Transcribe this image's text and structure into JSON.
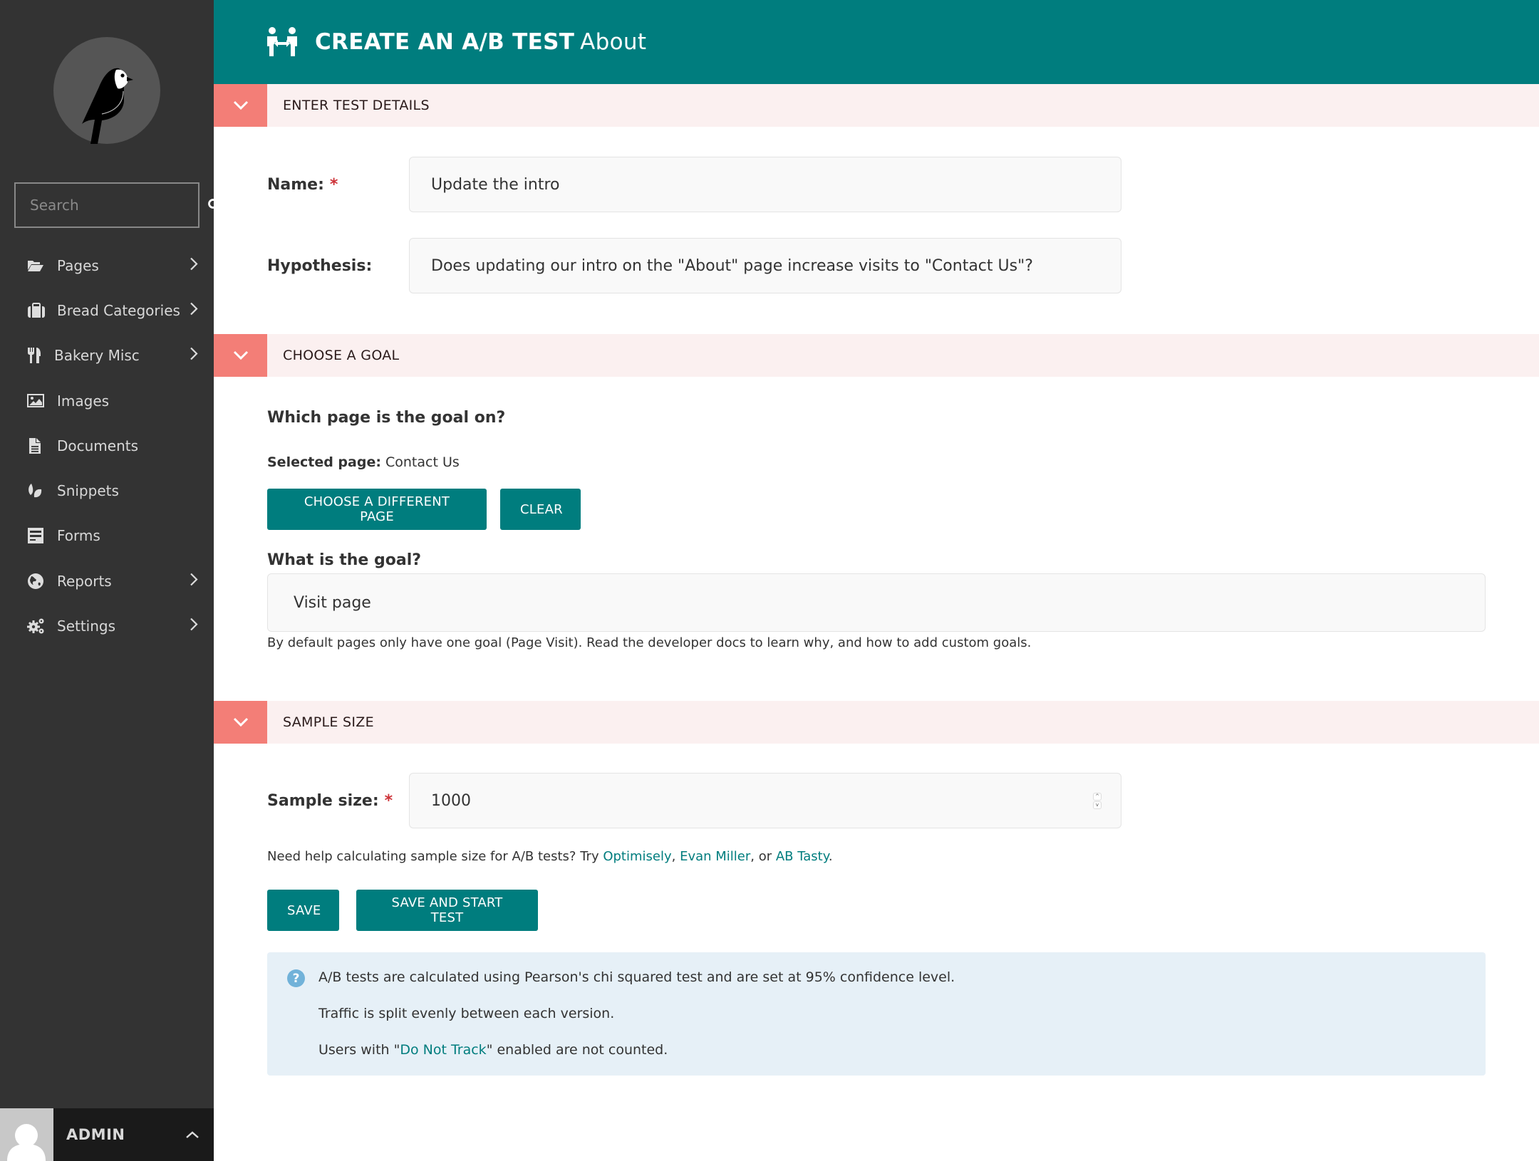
{
  "sidebar": {
    "search": {
      "placeholder": "Search"
    },
    "items": [
      {
        "label": "Pages",
        "icon": "folder-open-icon",
        "has_submenu": true
      },
      {
        "label": "Bread Categories",
        "icon": "suitcase-icon",
        "has_submenu": true
      },
      {
        "label": "Bakery Misc",
        "icon": "utensils-icon",
        "has_submenu": true
      },
      {
        "label": "Images",
        "icon": "image-icon",
        "has_submenu": false
      },
      {
        "label": "Documents",
        "icon": "document-icon",
        "has_submenu": false
      },
      {
        "label": "Snippets",
        "icon": "snippet-leaf-icon",
        "has_submenu": false
      },
      {
        "label": "Forms",
        "icon": "form-icon",
        "has_submenu": false
      },
      {
        "label": "Reports",
        "icon": "globe-icon",
        "has_submenu": true
      },
      {
        "label": "Settings",
        "icon": "cogs-icon",
        "has_submenu": true
      }
    ],
    "account": {
      "name": "ADMIN"
    }
  },
  "header": {
    "title": "CREATE AN A/B TEST",
    "subtitle": "About",
    "icon": "people-split-icon"
  },
  "sections": {
    "details": {
      "title": "ENTER TEST DETAILS",
      "name_label": "Name:",
      "name_value": "Update the intro",
      "hypothesis_label": "Hypothesis:",
      "hypothesis_value": "Does updating our intro on the \"About\" page increase visits to \"Contact Us\"?"
    },
    "goal": {
      "title": "CHOOSE A GOAL",
      "question": "Which page is the goal on?",
      "selected_label": "Selected page:",
      "selected_value": "Contact Us",
      "choose_button": "CHOOSE A DIFFERENT PAGE",
      "clear_button": "CLEAR",
      "goal_question": "What is the goal?",
      "goal_value": "Visit page",
      "goal_help": "By default pages only have one goal (Page Visit). Read the developer docs to learn why, and how to add custom goals."
    },
    "sample": {
      "title": "SAMPLE SIZE",
      "label": "Sample size:",
      "value": "1000",
      "help_prefix": "Need help calculating sample size for A/B tests? Try ",
      "links": [
        "Optimisely",
        "Evan Miller",
        "AB Tasty"
      ],
      "sep1": ", ",
      "sep2": ", or ",
      "help_suffix": "."
    }
  },
  "actions": {
    "save": "SAVE",
    "save_start": "SAVE AND START TEST"
  },
  "info": {
    "line1": "A/B tests are calculated using Pearson's chi squared test and are set at 95% confidence level.",
    "line2": "Traffic is split evenly between each version.",
    "line3_prefix": "Users with \"",
    "line3_link": "Do Not Track",
    "line3_suffix": "\" enabled are not counted."
  },
  "colors": {
    "brand_teal": "#007d7e",
    "sidebar_bg": "#333333",
    "section_accent": "#f37e77",
    "section_bg": "#fbf0f0",
    "info_bg": "#e6f0f7",
    "required": "#cd3238"
  }
}
